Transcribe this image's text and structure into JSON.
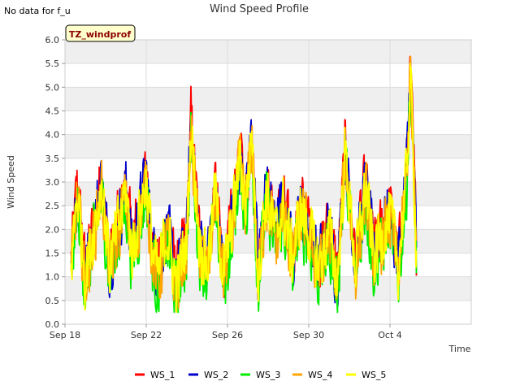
{
  "note": "No data for f_u",
  "tag": "TZ_windprof",
  "colors": {
    "WS_1": "#ff0000",
    "WS_2": "#0000cc",
    "WS_3": "#00ee00",
    "WS_4": "#ffa500",
    "WS_5": "#ffff00",
    "band": "#efefef",
    "tag_bg": "#ffffcc"
  },
  "chart_data": {
    "type": "line",
    "title": "Wind Speed Profile",
    "xlabel": "Time",
    "ylabel": "Wind Speed",
    "x_start": "2023-09-18",
    "x_end": "2023-10-08",
    "x_ticks": [
      {
        "day": 0,
        "label": "Sep 18"
      },
      {
        "day": 4,
        "label": "Sep 22"
      },
      {
        "day": 8,
        "label": "Sep 26"
      },
      {
        "day": 12,
        "label": "Sep 30"
      },
      {
        "day": 16,
        "label": "Oct 4"
      }
    ],
    "ylim": [
      0.0,
      6.0
    ],
    "y_ticks": [
      "0.0",
      "0.5",
      "1.0",
      "1.5",
      "2.0",
      "2.5",
      "3.0",
      "3.5",
      "4.0",
      "4.5",
      "5.0",
      "5.5",
      "6.0"
    ],
    "grid": true,
    "legend_position": "bottom",
    "series": [
      {
        "name": "WS_1",
        "offset": 0.15
      },
      {
        "name": "WS_2",
        "offset": 0.08
      },
      {
        "name": "WS_3",
        "offset": -0.25
      },
      {
        "name": "WS_4",
        "offset": -0.12
      },
      {
        "name": "WS_5",
        "offset": 0.0
      }
    ],
    "base_profile": [
      [
        0.3,
        1.2
      ],
      [
        0.6,
        2.8
      ],
      [
        1.0,
        1.0
      ],
      [
        1.5,
        2.2
      ],
      [
        1.8,
        3.0
      ],
      [
        2.2,
        1.2
      ],
      [
        2.6,
        2.0
      ],
      [
        3.0,
        2.8
      ],
      [
        3.3,
        1.5
      ],
      [
        3.7,
        2.4
      ],
      [
        4.0,
        3.1
      ],
      [
        4.3,
        1.5
      ],
      [
        4.6,
        1.0
      ],
      [
        5.0,
        2.0
      ],
      [
        5.5,
        0.8
      ],
      [
        6.0,
        1.8
      ],
      [
        6.2,
        4.2
      ],
      [
        6.6,
        1.8
      ],
      [
        7.0,
        1.2
      ],
      [
        7.4,
        2.8
      ],
      [
        7.8,
        1.0
      ],
      [
        8.2,
        2.0
      ],
      [
        8.6,
        3.5
      ],
      [
        8.9,
        2.5
      ],
      [
        9.2,
        4.1
      ],
      [
        9.5,
        1.0
      ],
      [
        9.9,
        2.8
      ],
      [
        10.4,
        1.8
      ],
      [
        10.7,
        2.5
      ],
      [
        11.2,
        1.4
      ],
      [
        11.6,
        2.4
      ],
      [
        12.0,
        2.0
      ],
      [
        12.5,
        1.2
      ],
      [
        13.0,
        2.0
      ],
      [
        13.4,
        0.9
      ],
      [
        13.8,
        3.6
      ],
      [
        14.3,
        1.2
      ],
      [
        14.8,
        2.9
      ],
      [
        15.2,
        1.4
      ],
      [
        15.7,
        2.0
      ],
      [
        16.0,
        2.3
      ],
      [
        16.4,
        1.2
      ],
      [
        16.8,
        3.0
      ],
      [
        17.0,
        5.3
      ],
      [
        17.3,
        1.6
      ]
    ]
  },
  "legend": [
    "WS_1",
    "WS_2",
    "WS_3",
    "WS_4",
    "WS_5"
  ]
}
